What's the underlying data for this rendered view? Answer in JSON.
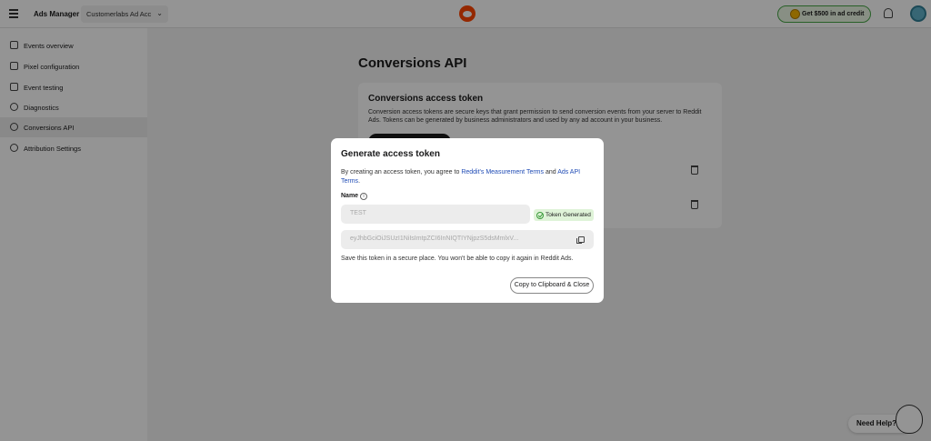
{
  "topbar": {
    "app_name": "Ads Manager",
    "account": "Customerlabs Ad Acc",
    "credit_label": "Get $500 in ad credit"
  },
  "sidebar": {
    "items": [
      {
        "label": "Events overview",
        "icon": "grid-icon"
      },
      {
        "label": "Pixel configuration",
        "icon": "code-icon"
      },
      {
        "label": "Event testing",
        "icon": "wrench-icon"
      },
      {
        "label": "Diagnostics",
        "icon": "info-icon"
      },
      {
        "label": "Conversions API",
        "icon": "api-icon",
        "active": true
      },
      {
        "label": "Attribution Settings",
        "icon": "gear-icon"
      }
    ]
  },
  "main": {
    "title": "Conversions API",
    "card_title": "Conversions access token",
    "card_text": "Conversion access tokens are secure keys that grant permission to send conversion events from your server to Reddit Ads. Tokens can be generated by business administrators and used by any ad account in your business."
  },
  "help": {
    "label": "Need Help?"
  },
  "modal": {
    "title": "Generate access token",
    "terms_prefix": "By creating an access token, you agree to ",
    "terms_link1": "Reddit's Measurement Terms",
    "terms_and": " and ",
    "terms_link2": "Ads API Terms",
    "terms_suffix": ".",
    "name_label": "Name",
    "name_value": "TEST",
    "badge": "Token Generated",
    "token_value": "eyJhbGciOiJSUzI1NiIsImtpZCI6InNIQTIYNjpzS5dsMmlxV...",
    "save_note": "Save this token in a secure place. You won't be able to copy it again in Reddit Ads.",
    "copy_close_label": "Copy to Clipboard & Close"
  },
  "colors": {
    "brand": "#ff4500",
    "link": "#1f4bb5",
    "success_bg": "#dff3d8",
    "success": "#3a9a3a"
  }
}
